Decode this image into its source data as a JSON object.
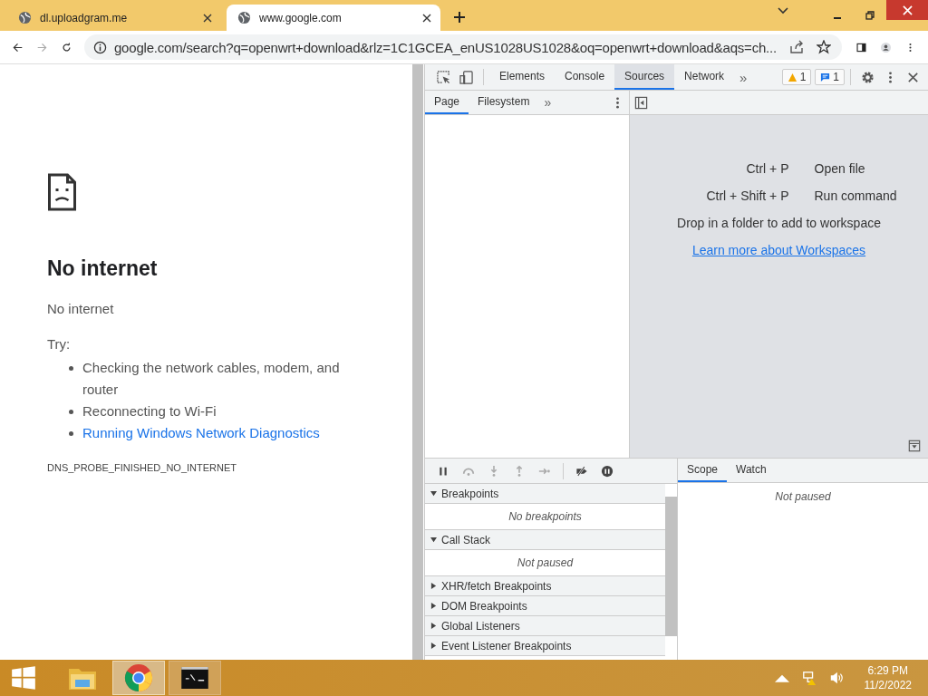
{
  "browser": {
    "tabs": [
      {
        "title": "dl.uploadgram.me",
        "selected": false
      },
      {
        "title": "www.google.com",
        "selected": true
      }
    ],
    "address": {
      "url": "google.com/search?q=openwrt+download&rlz=1C1GCEA_enUS1028US1028&oq=openwrt+download&aqs=ch..."
    }
  },
  "page": {
    "title": "No internet",
    "message": "No internet",
    "try_label": "Try:",
    "suggestions": [
      {
        "text": "Checking the network cables, modem, and router",
        "kind": "text"
      },
      {
        "text": "Reconnecting to Wi-Fi",
        "kind": "text"
      },
      {
        "text": "Running Windows Network Diagnostics",
        "kind": "link"
      }
    ],
    "error_code": "DNS_PROBE_FINISHED_NO_INTERNET"
  },
  "devtools": {
    "tabs": [
      {
        "label": "Elements",
        "selected": false
      },
      {
        "label": "Console",
        "selected": false
      },
      {
        "label": "Sources",
        "selected": true
      },
      {
        "label": "Network",
        "selected": false
      }
    ],
    "more": "»",
    "warnings": "1",
    "messages": "1",
    "navigator_tabs": [
      {
        "label": "Page",
        "selected": true
      },
      {
        "label": "Filesystem",
        "selected": false
      }
    ],
    "shortcuts": [
      {
        "keys": "Ctrl + P",
        "action": "Open file"
      },
      {
        "keys": "Ctrl + Shift + P",
        "action": "Run command"
      }
    ],
    "drop_text": "Drop in a folder to add to workspace",
    "workspace_link": "Learn more about Workspaces",
    "sections": [
      {
        "title": "Breakpoints",
        "expanded": true,
        "content": "No breakpoints"
      },
      {
        "title": "Call Stack",
        "expanded": true,
        "content": "Not paused"
      },
      {
        "title": "XHR/fetch Breakpoints",
        "expanded": false
      },
      {
        "title": "DOM Breakpoints",
        "expanded": false
      },
      {
        "title": "Global Listeners",
        "expanded": false
      },
      {
        "title": "Event Listener Breakpoints",
        "expanded": false
      }
    ],
    "scope_tabs": [
      {
        "label": "Scope",
        "selected": true
      },
      {
        "label": "Watch",
        "selected": false
      }
    ],
    "scope_message": "Not paused"
  },
  "taskbar": {
    "apps": [
      {
        "kind": "folder",
        "selected": false
      },
      {
        "kind": "chrome",
        "selected": true
      },
      {
        "kind": "terminal",
        "selected": false
      }
    ],
    "time": "6:29 PM",
    "date": "11/2/2022"
  }
}
